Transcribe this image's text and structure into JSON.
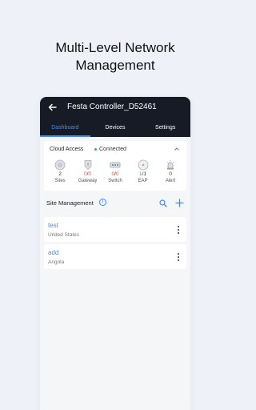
{
  "headline": {
    "line1": "Multi-Level Network",
    "line2": "Management"
  },
  "appbar": {
    "title": "Festa Controller_D52461"
  },
  "tabs": [
    {
      "label": "Dashboard",
      "active": true
    },
    {
      "label": "Devices",
      "active": false
    },
    {
      "label": "Settings",
      "active": false
    }
  ],
  "cloud": {
    "label": "Cloud Access",
    "status": "Connected",
    "status_color": "#2db84d"
  },
  "devices": [
    {
      "icon": "sites-icon",
      "count": "2",
      "name": "Sites"
    },
    {
      "icon": "gateway-icon",
      "count_a": "0",
      "count_b": "0",
      "name": "Gateway"
    },
    {
      "icon": "switch-icon",
      "count_a": "0",
      "count_b": "0",
      "name": "Switch"
    },
    {
      "icon": "eap-icon",
      "count_a": "1",
      "count_b": "1",
      "name": "EAP"
    },
    {
      "icon": "alert-icon",
      "count": "0",
      "name": "Alert"
    }
  ],
  "site_management": {
    "title": "Site Management",
    "info": "i"
  },
  "sites": [
    {
      "name": "test",
      "country": "United States"
    },
    {
      "name": "add",
      "country": "Angola"
    }
  ],
  "colors": {
    "accent": "#3f8bff",
    "appbar": "#161b26",
    "background": "#eef2f8"
  }
}
